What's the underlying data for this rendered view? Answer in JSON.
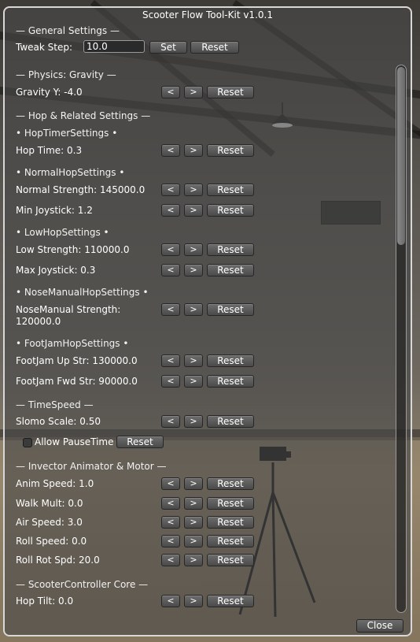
{
  "window": {
    "title": "Scooter Flow Tool-Kit v1.0.1",
    "close_label": "Close"
  },
  "general": {
    "header": "— General Settings —",
    "tweak_label": "Tweak Step:",
    "tweak_value": "10.0",
    "set_label": "Set",
    "reset_label": "Reset"
  },
  "physics": {
    "header": "— Physics: Gravity —",
    "gravity": "Gravity Y: -4.0"
  },
  "hop": {
    "header": "— Hop & Related Settings —",
    "timer_header": "• HopTimerSettings •",
    "hop_time": "Hop Time: 0.3",
    "normal_header": "• NormalHopSettings •",
    "normal_strength": "Normal Strength: 145000.0",
    "min_joystick": "Min Joystick: 1.2",
    "low_header": "• LowHopSettings •",
    "low_strength": "Low Strength: 110000.0",
    "max_joystick": "Max Joystick: 0.3",
    "nose_header": "• NoseManualHopSettings •",
    "nose_strength_line1": "NoseManual Strength:",
    "nose_strength_line2": "120000.0",
    "footjam_header": "• FootJamHopSettings •",
    "footjam_up": "FootJam Up Str: 130000.0",
    "footjam_fwd": "FootJam Fwd Str: 90000.0"
  },
  "time": {
    "header": "— TimeSpeed —",
    "slomo": "Slomo Scale: 0.50",
    "allow_pause": "Allow PauseTime",
    "allow_pause_checked": false
  },
  "invector": {
    "header": "— Invector Animator & Motor —",
    "anim_speed": "Anim Speed: 1.0",
    "walk_mult": "Walk Mult: 0.0",
    "air_speed": "Air Speed: 3.0",
    "roll_speed": "Roll Speed: 0.0",
    "roll_rot": "Roll Rot Spd: 20.0"
  },
  "core": {
    "header": "— ScooterController Core —",
    "hop_tilt": "Hop Tilt: 0.0"
  },
  "controls": {
    "dec": "<",
    "inc": ">",
    "reset": "Reset"
  }
}
